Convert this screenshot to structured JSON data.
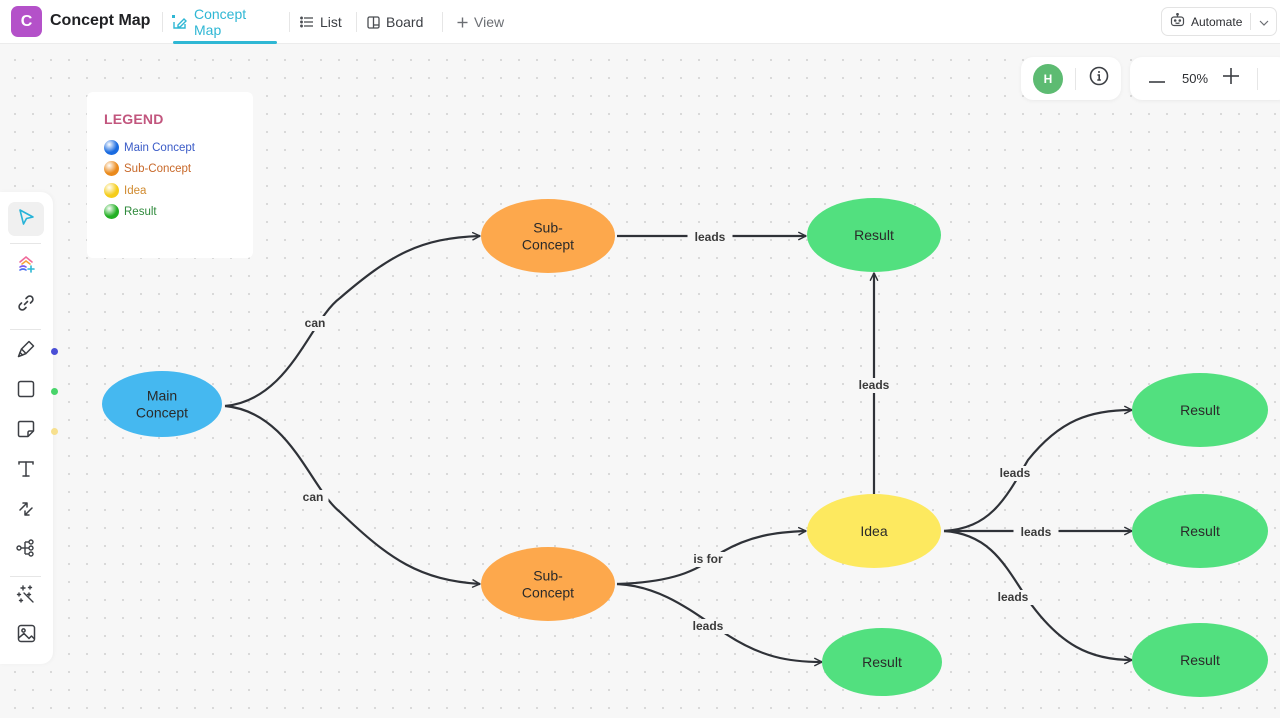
{
  "header": {
    "app_initial": "C",
    "app_title": "Concept Map",
    "tabs": [
      {
        "label": "Concept Map",
        "icon": "concept-map-icon",
        "active": true
      },
      {
        "label": "List",
        "icon": "list-icon",
        "active": false
      },
      {
        "label": "Board",
        "icon": "board-icon",
        "active": false
      },
      {
        "label": "View",
        "icon": "plus-icon",
        "active": false
      }
    ],
    "automate_label": "Automate"
  },
  "canvas_controls": {
    "user_initial": "H",
    "zoom_level": "50%"
  },
  "legend": {
    "title": "LEGEND",
    "items": [
      {
        "label": "Main Concept",
        "color": "#1a6be0",
        "text_color": "#3a5bc7"
      },
      {
        "label": "Sub-Concept",
        "color": "#ea8a1c",
        "text_color": "#c8692a"
      },
      {
        "label": "Idea",
        "color": "#f5cd1a",
        "text_color": "#d08a2e"
      },
      {
        "label": "Result",
        "color": "#22b024",
        "text_color": "#2f8a3c"
      }
    ]
  },
  "toolbar": {
    "tools": [
      {
        "name": "select",
        "icon": "cursor-icon",
        "selected": true
      },
      {
        "name": "ai-create",
        "icon": "ai-shapes-icon"
      },
      {
        "name": "link",
        "icon": "link-icon"
      },
      {
        "name": "pen",
        "icon": "pen-icon",
        "color": "#4a4fd6"
      },
      {
        "name": "shape",
        "icon": "square-icon",
        "color": "#48d46a"
      },
      {
        "name": "sticky-note",
        "icon": "sticky-note-icon",
        "color": "#f7e08e"
      },
      {
        "name": "text",
        "icon": "text-icon"
      },
      {
        "name": "connector",
        "icon": "connector-icon"
      },
      {
        "name": "mind-map",
        "icon": "mind-map-icon"
      },
      {
        "name": "magic",
        "icon": "magic-wand-icon"
      },
      {
        "name": "image",
        "icon": "image-icon"
      }
    ]
  },
  "diagram": {
    "colors": {
      "main": "#45b8f0",
      "sub": "#fda84c",
      "idea": "#fde95f",
      "result": "#52e07f",
      "edge": "#2f3238"
    },
    "nodes": [
      {
        "id": "main",
        "type": "main",
        "lines": [
          "Main",
          "Concept"
        ]
      },
      {
        "id": "sub1",
        "type": "sub",
        "lines": [
          "Sub-",
          "Concept"
        ]
      },
      {
        "id": "sub2",
        "type": "sub",
        "lines": [
          "Sub-",
          "Concept"
        ]
      },
      {
        "id": "res1",
        "type": "result",
        "lines": [
          "Result"
        ]
      },
      {
        "id": "idea",
        "type": "idea",
        "lines": [
          "Idea"
        ]
      },
      {
        "id": "res2",
        "type": "result",
        "lines": [
          "Result"
        ]
      },
      {
        "id": "res3",
        "type": "result",
        "lines": [
          "Result"
        ]
      },
      {
        "id": "res4",
        "type": "result",
        "lines": [
          "Result"
        ]
      },
      {
        "id": "res5",
        "type": "result",
        "lines": [
          "Result"
        ]
      }
    ],
    "edges": [
      {
        "from": "main",
        "to": "sub1",
        "label": "can"
      },
      {
        "from": "main",
        "to": "sub2",
        "label": "can"
      },
      {
        "from": "sub1",
        "to": "res1",
        "label": "leads"
      },
      {
        "from": "sub2",
        "to": "idea",
        "label": "is for"
      },
      {
        "from": "sub2",
        "to": "res2",
        "label": "leads"
      },
      {
        "from": "idea",
        "to": "res1",
        "label": "leads"
      },
      {
        "from": "idea",
        "to": "res3",
        "label": "leads"
      },
      {
        "from": "idea",
        "to": "res4",
        "label": "leads"
      },
      {
        "from": "idea",
        "to": "res5",
        "label": "leads"
      }
    ]
  }
}
